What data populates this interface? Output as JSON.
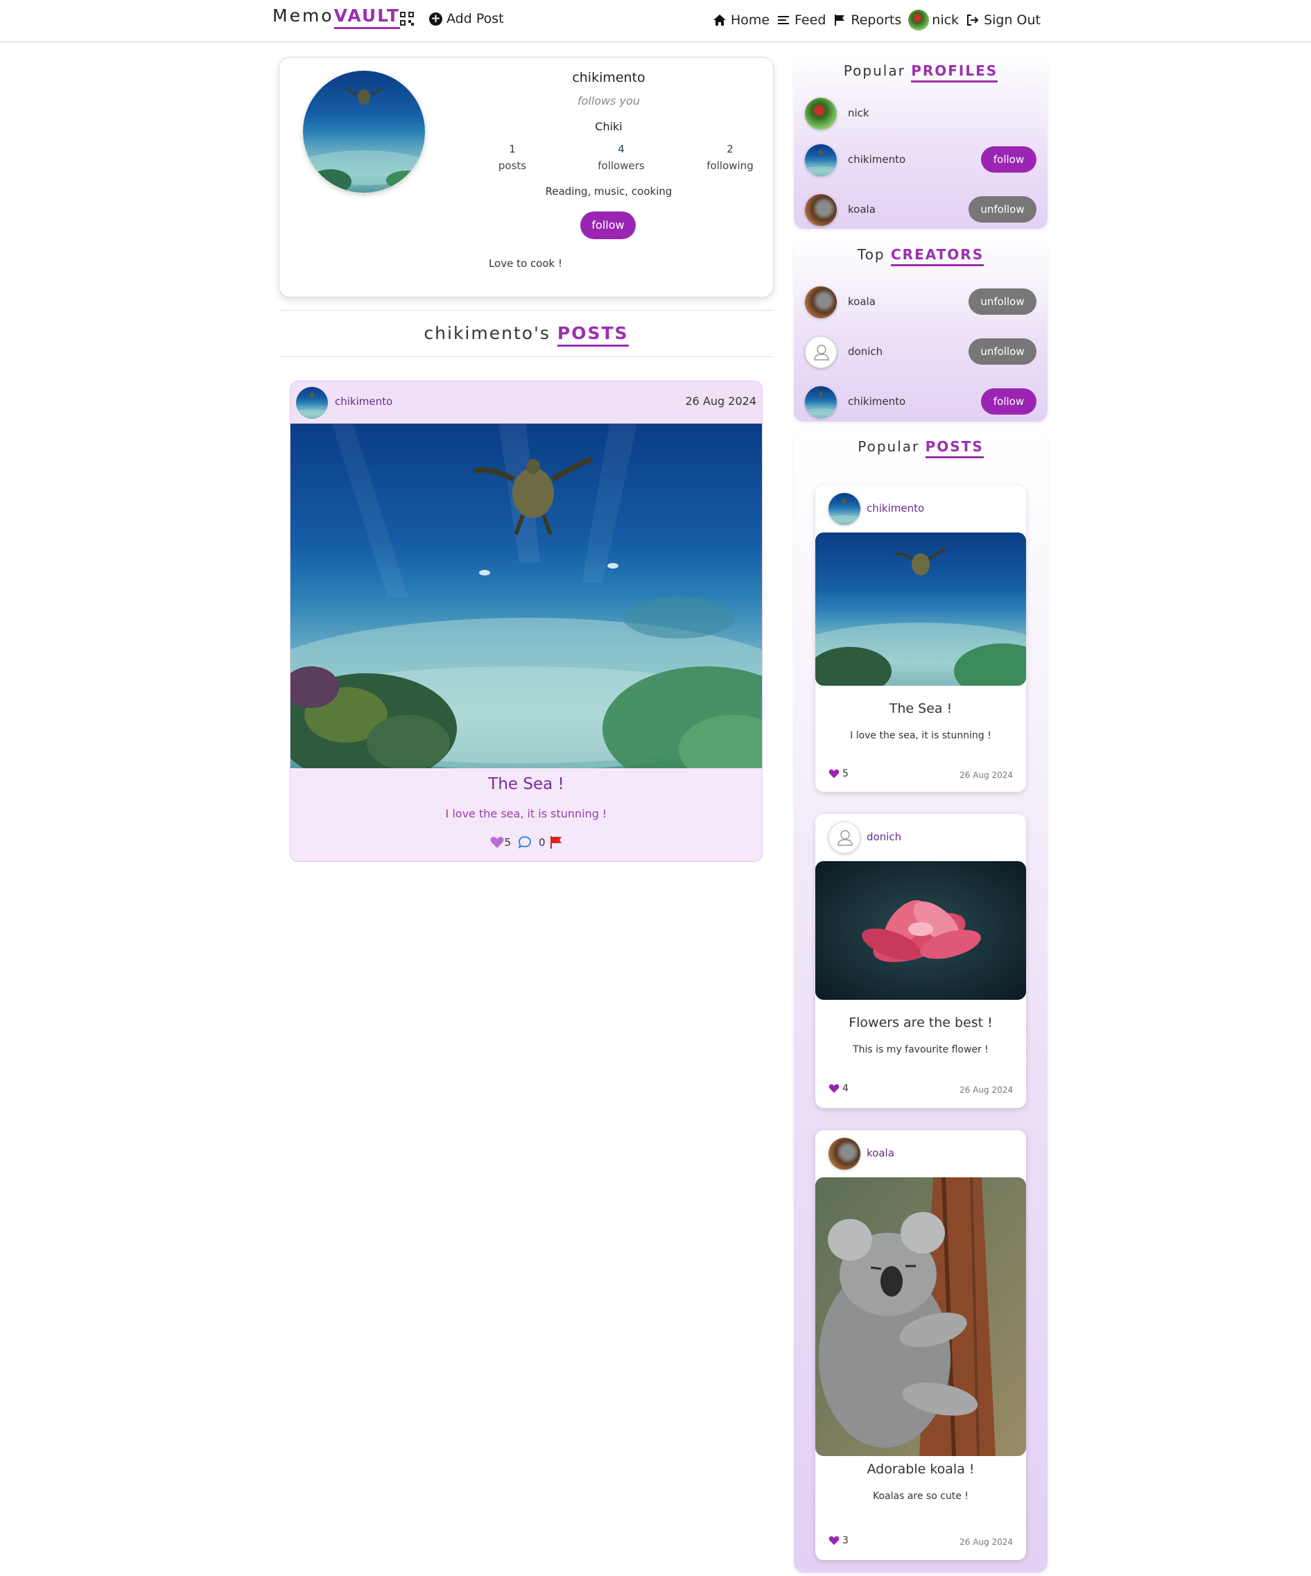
{
  "navbar": {
    "brand_prefix": "Memo",
    "brand_accent": "VAULT",
    "add_post": "Add Post",
    "home": "Home",
    "feed": "Feed",
    "reports": "Reports",
    "user": "nick",
    "sign_out": "Sign Out",
    "icons": [
      "qr-code-icon",
      "plus-circle-icon",
      "home-icon",
      "menu-icon",
      "flag-icon",
      "avatar",
      "sign-out-icon"
    ]
  },
  "profile": {
    "username": "chikimento",
    "follows_you": "follows you",
    "name": "Chiki",
    "stats": [
      {
        "value": "1",
        "label": "posts"
      },
      {
        "value": "4",
        "label": "followers"
      },
      {
        "value": "2",
        "label": "following"
      }
    ],
    "interests": "Reading, music, cooking",
    "follow_label": "follow",
    "bio": "Love to cook !"
  },
  "posts_section": {
    "prefix": "chikimento's",
    "accent": "POSTS"
  },
  "post": {
    "author": "chikimento",
    "date": "26 Aug 2024",
    "title": "The Sea !",
    "description": "I love the sea, it is stunning !",
    "likes": "5",
    "comments": "0"
  },
  "popular_profiles": {
    "prefix": "Popular",
    "accent": "PROFILES",
    "items": [
      {
        "name": "nick",
        "button": ""
      },
      {
        "name": "chikimento",
        "button": "follow"
      },
      {
        "name": "koala",
        "button": "unfollow"
      }
    ]
  },
  "top_creators": {
    "prefix": "Top",
    "accent": "CREATORS",
    "items": [
      {
        "name": "koala",
        "button": "unfollow"
      },
      {
        "name": "donich",
        "button": "unfollow"
      },
      {
        "name": "chikimento",
        "button": "follow"
      }
    ]
  },
  "popular_posts": {
    "prefix": "Popular",
    "accent": "POSTS",
    "items": [
      {
        "author": "chikimento",
        "title": "The Sea !",
        "description": "I love the sea, it is stunning !",
        "likes": "5",
        "date": "26 Aug 2024"
      },
      {
        "author": "donich",
        "title": "Flowers are the best !",
        "description": "This is my favourite flower !",
        "likes": "4",
        "date": "26 Aug 2024"
      },
      {
        "author": "koala",
        "title": "Adorable koala !",
        "description": "Koalas are so cute !",
        "likes": "3",
        "date": "26 Aug 2024"
      }
    ]
  },
  "colors": {
    "accent": "#9b25b3",
    "unfollow": "#777777",
    "flag": "#e0211b",
    "heart": "#9b3bb5"
  }
}
